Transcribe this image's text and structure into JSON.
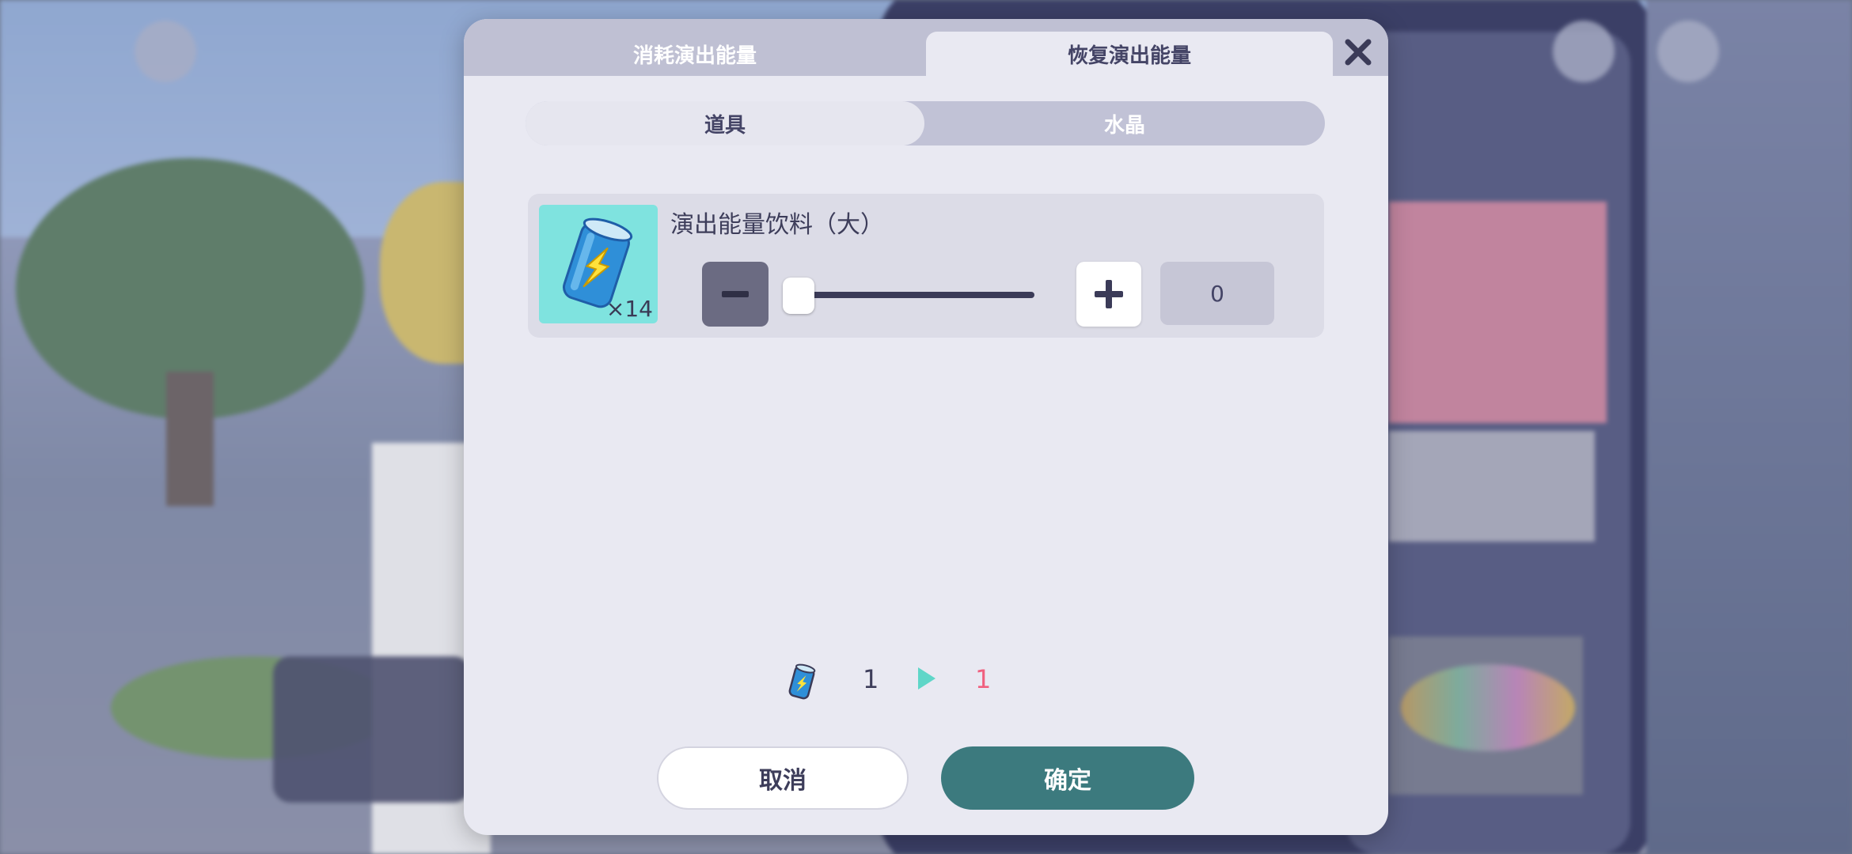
{
  "tabs": {
    "consume_label": "消耗演出能量",
    "restore_label": "恢复演出能量"
  },
  "segment": {
    "items_label": "道具",
    "crystal_label": "水晶"
  },
  "item": {
    "name": "演出能量饮料（大）",
    "count_text": "×14",
    "quantity": "0",
    "slider_fraction": 0.0
  },
  "summary": {
    "from_value": "1",
    "to_value": "1"
  },
  "buttons": {
    "cancel_label": "取消",
    "confirm_label": "确定"
  },
  "icons": {
    "close": "close-icon",
    "energy_can": "energy-drink-icon",
    "minus": "minus-icon",
    "plus": "plus-icon",
    "arrow": "play-arrow-icon"
  },
  "colors": {
    "accent_teal": "#3c7a7e",
    "highlight_pink": "#f0607f",
    "icon_bg": "#7fe3df"
  }
}
